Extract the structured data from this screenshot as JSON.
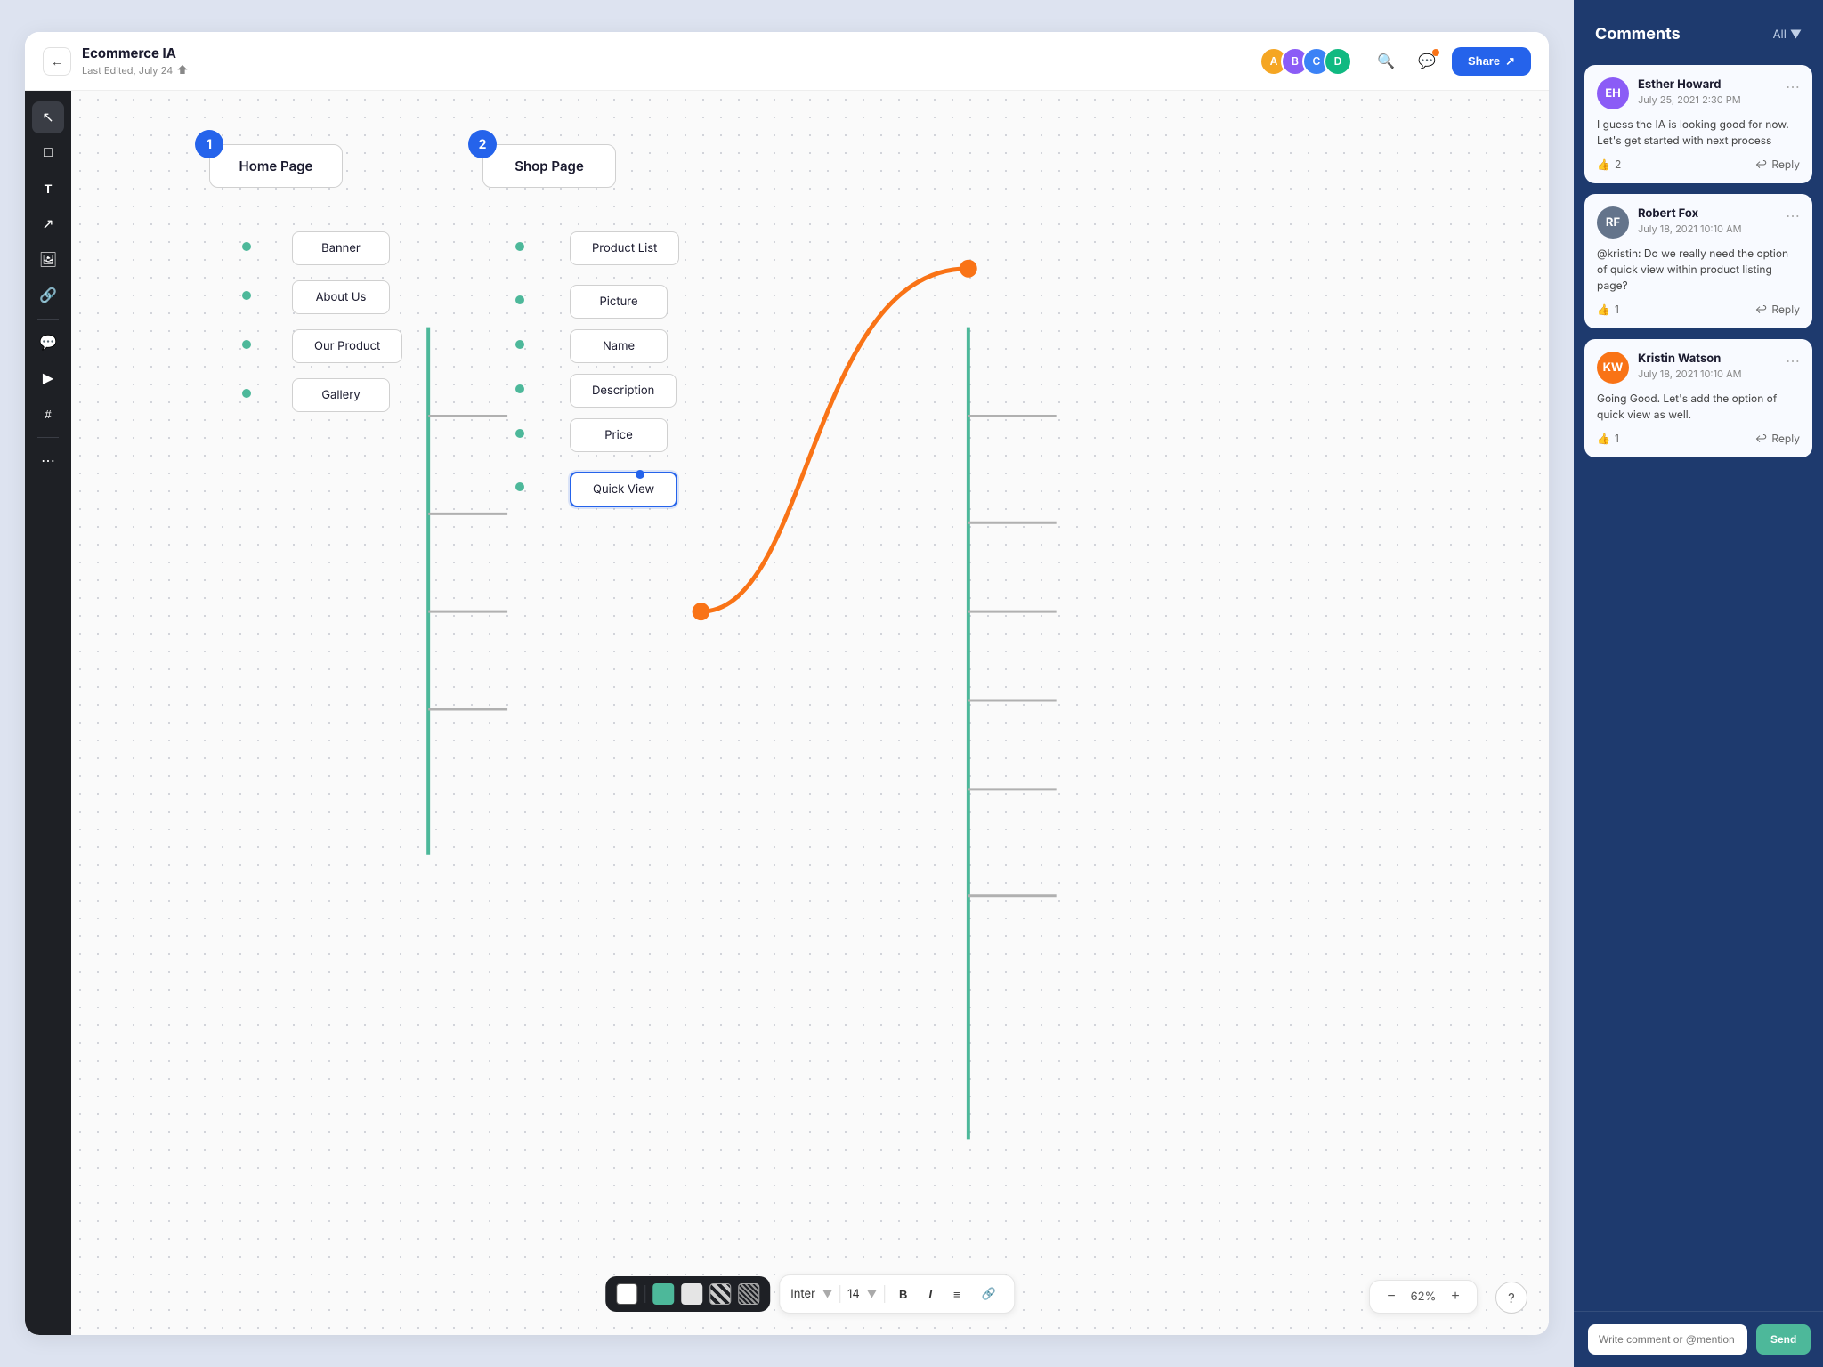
{
  "app": {
    "title": "Ecommerce IA",
    "subtitle": "Last Edited, July 24",
    "back_label": "←",
    "share_label": "Share"
  },
  "header": {
    "avatars": [
      {
        "color": "#f97316",
        "initials": "A"
      },
      {
        "color": "#8b5cf6",
        "initials": "B"
      },
      {
        "color": "#3b82f6",
        "initials": "C"
      },
      {
        "color": "#10b981",
        "initials": "D"
      }
    ]
  },
  "toolbar": {
    "tools": [
      {
        "name": "cursor",
        "icon": "↖",
        "active": true
      },
      {
        "name": "rectangle",
        "icon": "□",
        "active": false
      },
      {
        "name": "text",
        "icon": "T",
        "active": false
      },
      {
        "name": "arrow",
        "icon": "↗",
        "active": false
      },
      {
        "name": "image",
        "icon": "⊞",
        "active": false
      },
      {
        "name": "link",
        "icon": "⊕",
        "active": false
      },
      {
        "name": "comment",
        "icon": "💬",
        "active": false
      },
      {
        "name": "video",
        "icon": "▶",
        "active": false
      },
      {
        "name": "frame",
        "icon": "#",
        "active": false
      },
      {
        "name": "more",
        "icon": "⋯",
        "active": false
      }
    ]
  },
  "diagram": {
    "columns": [
      {
        "id": 1,
        "badge": "1",
        "main_node": "Home Page",
        "children": [
          "Banner",
          "About Us",
          "Our Product",
          "Gallery"
        ]
      },
      {
        "id": 2,
        "badge": "2",
        "main_node": "Shop Page",
        "children": [
          "Product List",
          "Picture",
          "Name",
          "Description",
          "Price",
          "Quick View"
        ]
      }
    ]
  },
  "bottom_toolbar": {
    "colors": [
      "#ffffff",
      "#4db89a",
      "#e5e5e5"
    ],
    "font_family": "Inter",
    "font_size": "14",
    "font_label": "Inter",
    "size_label": "14"
  },
  "zoom": {
    "level": "62%",
    "decrease": "−",
    "increase": "+"
  },
  "comments": {
    "title": "Comments",
    "filter": "All",
    "items": [
      {
        "id": 1,
        "author": "Esther Howard",
        "date": "July 25, 2021 2:30 PM",
        "text": "I guess the IA is looking good for now. Let's get started with next process",
        "likes": 2,
        "avatar_color": "#8b5cf6",
        "initials": "EH"
      },
      {
        "id": 2,
        "author": "Robert Fox",
        "date": "July 18, 2021 10:10 AM",
        "text": "@kristin: Do we really need the option of quick view within product listing page?",
        "likes": 1,
        "avatar_color": "#64748b",
        "initials": "RF"
      },
      {
        "id": 3,
        "author": "Kristin Watson",
        "date": "July 18, 2021 10:10 AM",
        "text": "Going Good. Let's add the option of quick view as well.",
        "likes": 1,
        "avatar_color": "#f97316",
        "initials": "KW"
      }
    ],
    "input_placeholder": "Write comment or @mention",
    "send_label": "Send",
    "reply_label": "Reply"
  }
}
